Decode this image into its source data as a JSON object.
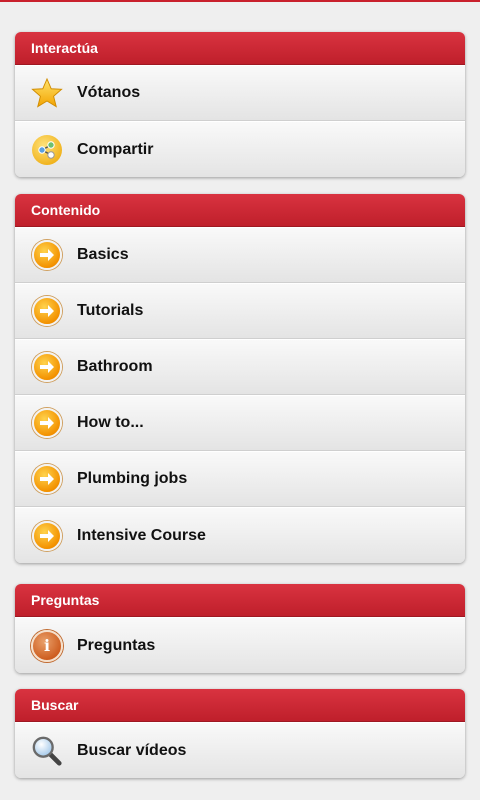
{
  "sections": [
    {
      "header": "Interactúa",
      "items": [
        {
          "label": "Vótanos",
          "icon": "star-icon"
        },
        {
          "label": "Compartir",
          "icon": "share-icon"
        }
      ]
    },
    {
      "header": "Contenido",
      "items": [
        {
          "label": "Basics",
          "icon": "arrow-right-icon"
        },
        {
          "label": "Tutorials",
          "icon": "arrow-right-icon"
        },
        {
          "label": "Bathroom",
          "icon": "arrow-right-icon"
        },
        {
          "label": "How to...",
          "icon": "arrow-right-icon"
        },
        {
          "label": "Plumbing jobs",
          "icon": "arrow-right-icon"
        },
        {
          "label": "Intensive Course",
          "icon": "arrow-right-icon"
        }
      ]
    },
    {
      "header": "Preguntas",
      "items": [
        {
          "label": "Preguntas",
          "icon": "info-icon"
        }
      ]
    },
    {
      "header": "Buscar",
      "items": [
        {
          "label": "Buscar vídeos",
          "icon": "search-icon"
        }
      ]
    }
  ],
  "colors": {
    "accent": "#c9202c",
    "background": "#efefef",
    "arrow": "#f39200"
  }
}
